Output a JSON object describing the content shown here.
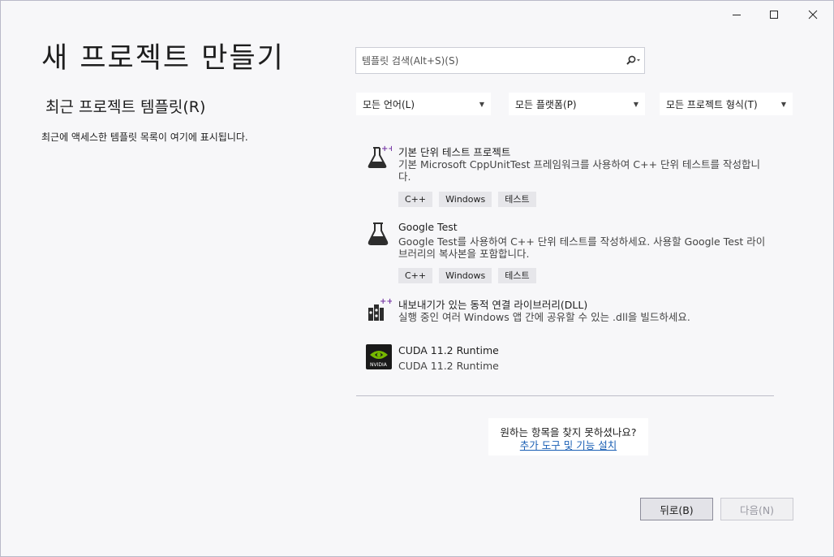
{
  "window_controls": {
    "minimize": "—",
    "maximize": "☐",
    "close": "✕"
  },
  "title": "새 프로젝트 만들기",
  "recent": {
    "title": "최근 프로젝트 템플릿(R)",
    "description": "최근에 액세스한 템플릿 목록이 여기에 표시됩니다."
  },
  "search": {
    "placeholder": "템플릿 검색(Alt+S)(S)"
  },
  "filters": [
    {
      "label": "모든 언어(L)"
    },
    {
      "label": "모든 플랫폼(P)"
    },
    {
      "label": "모든 프로젝트 형식(T)"
    }
  ],
  "templates": [
    {
      "name": "기본 단위 테스트 프로젝트",
      "description": "기본 Microsoft CppUnitTest 프레임워크를 사용하여 C++ 단위 테스트를 작성합니다.",
      "tags": [
        "C++",
        "Windows",
        "테스트"
      ],
      "icon": "flask-plus-icon"
    },
    {
      "name": "Google Test",
      "description": "Google Test를 사용하여 C++ 단위 테스트를 작성하세요. 사용할 Google Test 라이브러리의 복사본을 포함합니다.",
      "tags": [
        "C++",
        "Windows",
        "테스트"
      ],
      "icon": "flask-icon"
    },
    {
      "name": "내보내기가 있는 동적 연결 라이브러리(DLL)",
      "description": "실행 중인 여러 Windows 앱 간에 공유할 수 있는 .dll을 빌드하세요.",
      "tags": [],
      "icon": "dll-library-icon"
    },
    {
      "name": "CUDA 11.2 Runtime",
      "description": "CUDA 11.2 Runtime",
      "tags": [],
      "icon": "nvidia-icon"
    }
  ],
  "not_found": {
    "text": "원하는 항목을 찾지 못하셨나요?",
    "link": "추가 도구 및 기능 설치"
  },
  "buttons": {
    "back": "뒤로(B)",
    "next": "다음(N)"
  },
  "colors": {
    "accent_link": "#1a5fb4",
    "nvidia_green": "#76b900"
  }
}
